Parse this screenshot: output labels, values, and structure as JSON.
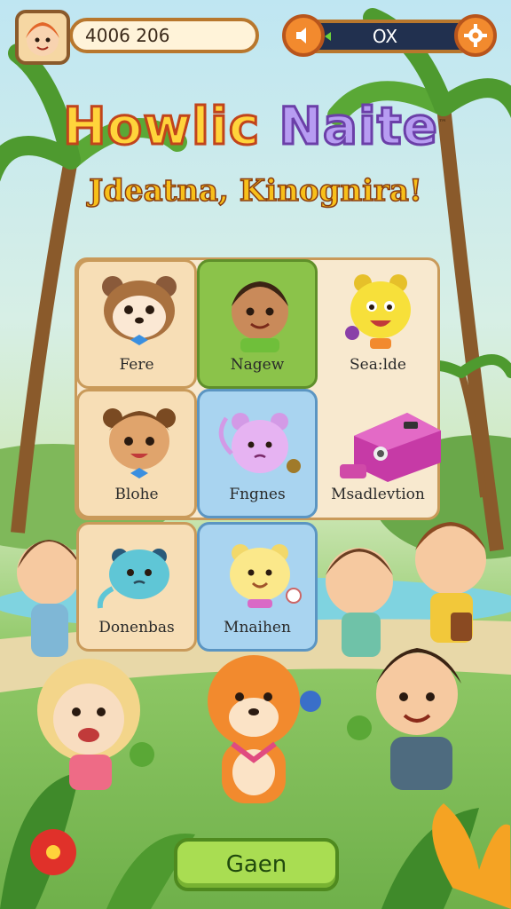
{
  "hud": {
    "score": "4006 206",
    "status": "OX"
  },
  "title": {
    "line1_a": "Howlic",
    "line1_b": "Naite",
    "tm": "™",
    "line2": "Jdeatna, Kinognira!"
  },
  "grid": {
    "tiles": [
      {
        "label": "Fere",
        "style": "cream",
        "icon": "raccoon-character-icon"
      },
      {
        "label": "Nagew",
        "style": "green",
        "icon": "boy-character-icon"
      },
      {
        "label": "Sea:lde",
        "style": "plain",
        "icon": "yellow-bear-character-icon"
      },
      {
        "label": "Blohe",
        "style": "cream",
        "icon": "bear-kid-character-icon"
      },
      {
        "label": "Fngnes",
        "style": "blue",
        "icon": "pink-monkey-character-icon"
      },
      {
        "label": "Msadlevtion",
        "style": "plain",
        "icon": "toy-machine-icon"
      },
      {
        "label": "Donenbas",
        "style": "cream",
        "icon": "blue-blob-character-icon"
      },
      {
        "label": "Mnaihen",
        "style": "blue",
        "icon": "yellow-cat-character-icon"
      }
    ]
  },
  "footer": {
    "button_label": "Gaen"
  },
  "colors": {
    "sky": "#bfe6f2",
    "grass": "#6fb04a",
    "accent_orange": "#f28a2e",
    "title_yellow": "#ffd43b",
    "title_purple": "#b79cf2",
    "button_green": "#a9dd52"
  }
}
